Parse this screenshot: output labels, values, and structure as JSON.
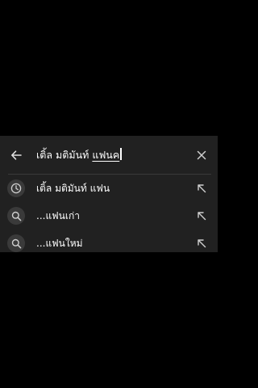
{
  "search": {
    "query_prefix": "เติ้ล มติมันท์ ",
    "query_composing": "แฟนค",
    "back_icon": "arrow-left-icon",
    "clear_icon": "close-icon"
  },
  "suggestions": [
    {
      "type": "history",
      "icon": "clock-icon",
      "text": "เติ้ล มติมันท์ แฟน",
      "action_icon": "arrow-up-left-icon"
    },
    {
      "type": "search",
      "icon": "search-icon",
      "text": "...แฟนเก่า",
      "action_icon": "arrow-up-left-icon"
    },
    {
      "type": "search",
      "icon": "search-icon",
      "text": "...แฟนใหม่",
      "action_icon": "arrow-up-left-icon"
    }
  ],
  "colors": {
    "background": "#000000",
    "panel": "#212121",
    "text": "#ffffff",
    "icon": "#d0d0d0",
    "icon_bg": "#3a3a3a",
    "divider": "#3a3a3a"
  }
}
